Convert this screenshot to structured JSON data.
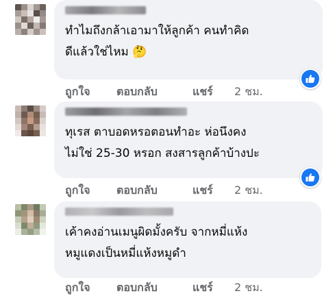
{
  "comments": [
    {
      "author": "",
      "text_lines": [
        "ทำไมถึงกล้าเอามาให้ลูกค้า คนทำคิด",
        "ดีแล้วใช่ไหม 🤔"
      ],
      "reaction": "like",
      "actions": {
        "like": "ถูกใจ",
        "reply": "ตอบกลับ",
        "share": "แชร์",
        "time": "2 ชม."
      }
    },
    {
      "author": "",
      "text_lines": [
        "ทุเรส ตาบอดหรอตอนทำอะ ห่อนึงคง",
        "ไม่ใช่ 25-30 หรอก สงสารลูกค้าบ้างปะ"
      ],
      "reaction": "like",
      "actions": {
        "like": "ถูกใจ",
        "reply": "ตอบกลับ",
        "share": "แชร์",
        "time": "2 ชม."
      }
    },
    {
      "author": "",
      "text_lines": [
        "เค้าคงอ่านเมนูผิดมั้งครับ จากหมี่แห้ง",
        "หมูแดงเป็นหมี่แห้งหมูดำ"
      ],
      "reaction": "",
      "actions": {
        "like": "ถูกใจ",
        "reply": "ตอบกลับ",
        "share": "แชร์",
        "time": "2 ชม."
      }
    }
  ],
  "colors": {
    "bubble": "#f0f2f5",
    "action_text": "#65676b",
    "like_blue": "#1877f2",
    "text": "#050505"
  },
  "icons": {
    "reaction": "thumbs-up-icon",
    "avatar": "pixelated-avatar"
  }
}
